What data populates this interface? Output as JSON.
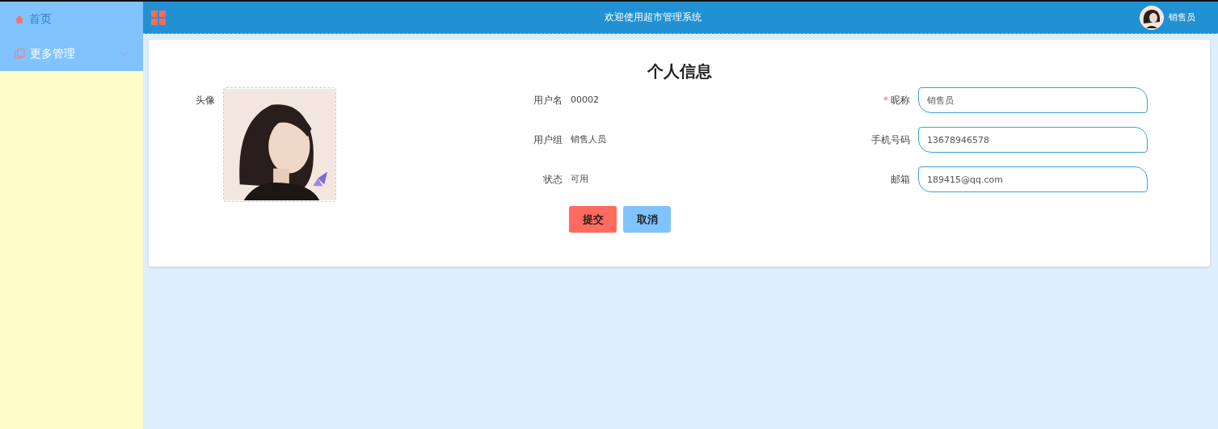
{
  "sidebar": {
    "items": [
      {
        "label": "首页",
        "kind": "home",
        "selected": true,
        "expandable": false
      },
      {
        "label": "更多管理",
        "kind": "copy",
        "selected": false,
        "expandable": true
      }
    ]
  },
  "header": {
    "title": "欢迎使用超市管理系统",
    "user": "销售员"
  },
  "profile": {
    "title": "个人信息",
    "avatar_label": "头像",
    "info": [
      {
        "label": "用户名",
        "value": "00002"
      },
      {
        "label": "用户组",
        "value": "销售人员"
      },
      {
        "label": "状态",
        "value": "可用"
      }
    ],
    "fields": [
      {
        "label": "昵称",
        "required_mark": "*",
        "value": "销售员"
      },
      {
        "label": "手机号码",
        "value": "13678946578"
      },
      {
        "label": "邮箱",
        "value": "189415@qq.com"
      }
    ],
    "buttons": [
      {
        "label": "提交",
        "kind": "primary"
      },
      {
        "label": "取消",
        "kind": "secondary"
      }
    ]
  }
}
